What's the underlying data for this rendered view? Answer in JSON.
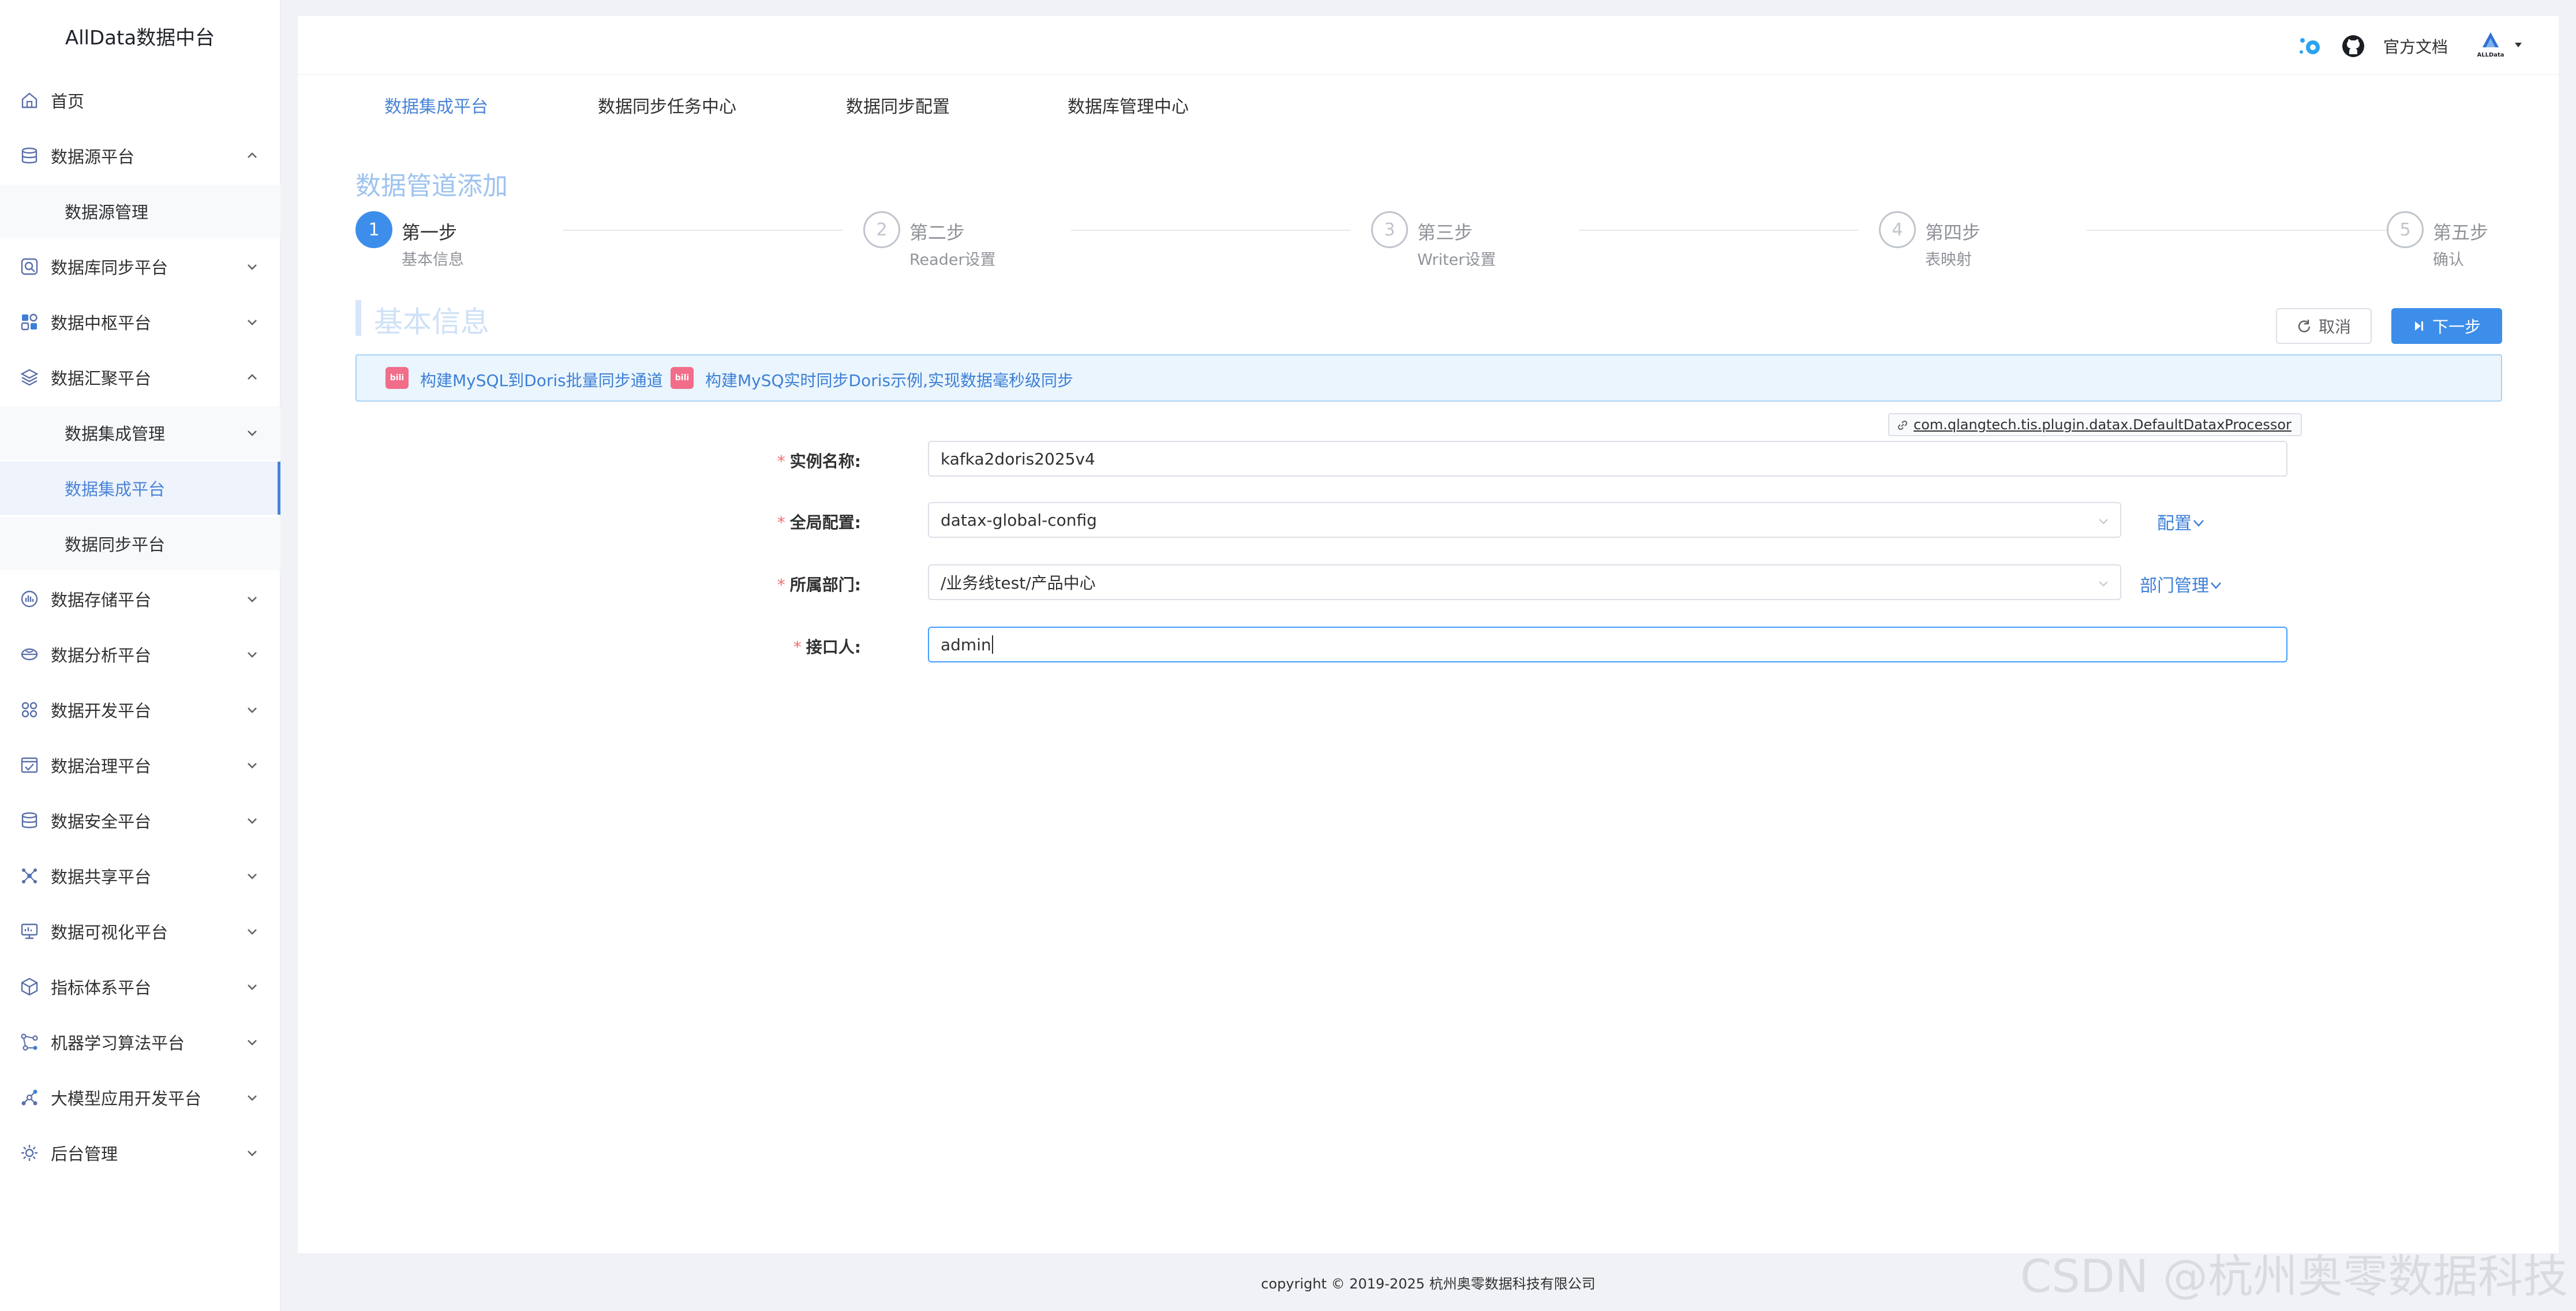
{
  "app": {
    "title": "AllData数据中台"
  },
  "sidebar": {
    "items": [
      {
        "label": "首页",
        "icon": "home-icon"
      },
      {
        "label": "数据源平台",
        "icon": "database-icon",
        "expanded": true
      },
      {
        "label": "数据源管理",
        "sub": true
      },
      {
        "label": "数据库同步平台",
        "icon": "sync-icon"
      },
      {
        "label": "数据中枢平台",
        "icon": "grid-icon"
      },
      {
        "label": "数据汇聚平台",
        "icon": "layers-icon",
        "expanded": true
      },
      {
        "label": "数据集成管理",
        "sub": true,
        "hasChildren": true
      },
      {
        "label": "数据集成平台",
        "sub": true,
        "active": true
      },
      {
        "label": "数据同步平台",
        "sub": true
      },
      {
        "label": "数据存储平台",
        "icon": "storage-icon"
      },
      {
        "label": "数据分析平台",
        "icon": "analysis-icon"
      },
      {
        "label": "数据开发平台",
        "icon": "develop-icon"
      },
      {
        "label": "数据治理平台",
        "icon": "governance-icon"
      },
      {
        "label": "数据安全平台",
        "icon": "security-icon"
      },
      {
        "label": "数据共享平台",
        "icon": "share-icon"
      },
      {
        "label": "数据可视化平台",
        "icon": "visual-icon"
      },
      {
        "label": "指标体系平台",
        "icon": "cube-icon"
      },
      {
        "label": "机器学习算法平台",
        "icon": "ml-icon"
      },
      {
        "label": "大模型应用开发平台",
        "icon": "llm-icon"
      },
      {
        "label": "后台管理",
        "icon": "admin-gear-icon"
      }
    ]
  },
  "header": {
    "docs_label": "官方文档",
    "avatar_label": "ALLData"
  },
  "tabs": [
    {
      "label": "数据集成平台",
      "active": true
    },
    {
      "label": "数据同步任务中心"
    },
    {
      "label": "数据同步配置"
    },
    {
      "label": "数据库管理中心"
    }
  ],
  "page": {
    "title": "数据管道添加"
  },
  "steps": [
    {
      "num": "1",
      "title": "第一步",
      "desc": "基本信息",
      "active": true
    },
    {
      "num": "2",
      "title": "第二步",
      "desc": "Reader设置"
    },
    {
      "num": "3",
      "title": "第三步",
      "desc": "Writer设置"
    },
    {
      "num": "4",
      "title": "第四步",
      "desc": "表映射"
    },
    {
      "num": "5",
      "title": "第五步",
      "desc": "确认"
    }
  ],
  "section": {
    "title": "基本信息"
  },
  "actions": {
    "cancel": "取消",
    "next": "下一步"
  },
  "notice": {
    "icon_text": "bili",
    "link1": "构建MySQL到Doris批量同步通道",
    "link2": "构建MySQ实时同步Doris示例,实现数据毫秒级同步"
  },
  "plugin": {
    "label": "com.qlangtech.tis.plugin.datax.DefaultDataxProcessor"
  },
  "form": {
    "instance_name": {
      "label": "实例名称:",
      "value": "kafka2doris2025v4"
    },
    "global_config": {
      "label": "全局配置:",
      "value": "datax-global-config",
      "extra": "配置"
    },
    "department": {
      "label": "所属部门:",
      "value": "/业务线test/产品中心",
      "extra": "部门管理"
    },
    "contact": {
      "label": "接口人:",
      "value": "admin"
    }
  },
  "footer": {
    "copyright": "copyright © 2019-2025 杭州奥零数据科技有限公司"
  },
  "watermark": "CSDN @杭州奥零数据科技"
}
